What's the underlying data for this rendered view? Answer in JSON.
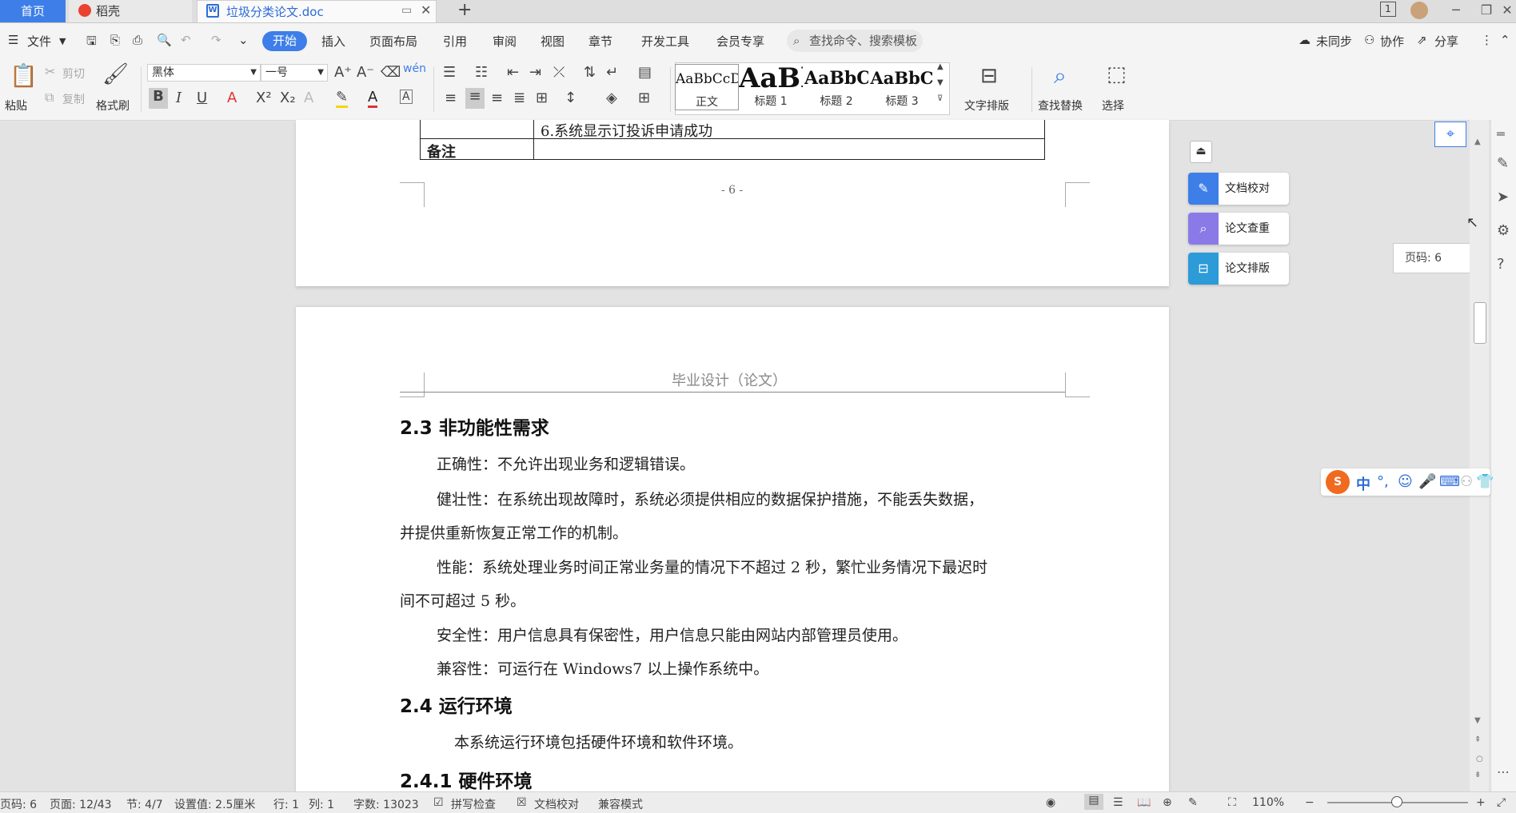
{
  "tabs": {
    "home": "首页",
    "daoke": "稻壳",
    "doc": "垃圾分类论文.doc",
    "new_tab": "+"
  },
  "window": {
    "page_count_icon": "1",
    "minimize": "─",
    "restore": "❐",
    "close": "✕"
  },
  "menubar": {
    "file": "文件",
    "items": [
      "开始",
      "插入",
      "页面布局",
      "引用",
      "审阅",
      "视图",
      "章节",
      "开发工具",
      "会员专享"
    ],
    "search_placeholder": "查找命令、搜索模板",
    "sync": "未同步",
    "collab": "协作",
    "share": "分享"
  },
  "ribbon": {
    "paste": "粘贴",
    "cut": "剪切",
    "copy": "复制",
    "format_painter": "格式刷",
    "font_name": "黑体",
    "font_size": "一号",
    "styles": [
      {
        "sample": "AaBbCcDd",
        "name": "正文"
      },
      {
        "sample": "AaBl",
        "name": "标题 1"
      },
      {
        "sample": "AaBbC",
        "name": "标题 2"
      },
      {
        "sample": "AaBbC",
        "name": "标题 3"
      }
    ],
    "text_layout": "文字排版",
    "find_replace": "查找替换",
    "select": "选择"
  },
  "doc": {
    "page1": {
      "table_row_text": "6.系统显示订投诉申请成功",
      "table_remark_label": "备注",
      "page_number": "- 6 -"
    },
    "page2": {
      "header": "毕业设计（论文）",
      "h_2_3": "2.3  非功能性需求",
      "p1": "正确性：不允许出现业务和逻辑错误。",
      "p2a": "健壮性：在系统出现故障时，系统必须提供相应的数据保护措施，不能丢失数据，",
      "p2b": "并提供重新恢复正常工作的机制。",
      "p3a": "性能：系统处理业务时间正常业务量的情况下不超过 2 秒，繁忙业务情况下最迟时",
      "p3b": "间不可超过 5 秒。",
      "p4": "安全性：用户信息具有保密性，用户信息只能由网站内部管理员使用。",
      "p5": "兼容性：可运行在 Windows7 以上操作系统中。",
      "h_2_4": "2.4  运行环境",
      "p6": "本系统运行环境包括硬件环境和软件环境。",
      "h_2_4_1": "2.4.1 硬件环境"
    }
  },
  "sidepanel": {
    "proofread": "文档校对",
    "plagiarism": "论文查重",
    "layout": "论文排版",
    "page_indicator": "页码: 6"
  },
  "ime": {
    "lang": "中"
  },
  "status": {
    "page_code": "页码: 6",
    "page": "页面: 12/43",
    "section": "节: 4/7",
    "setting": "设置值: 2.5厘米",
    "row": "行: 1",
    "col": "列: 1",
    "word_count": "字数: 13023",
    "spell_check": "拼写检查",
    "doc_proof": "文档校对",
    "compat_mode": "兼容模式",
    "zoom": "110%"
  },
  "colors": {
    "accent": "#3d7ee8",
    "tabbar_bg": "#dedede",
    "toolbar_bg": "#f4f4f4",
    "page_bg": "#ffffff",
    "workspace_bg": "#e3e3e3"
  }
}
